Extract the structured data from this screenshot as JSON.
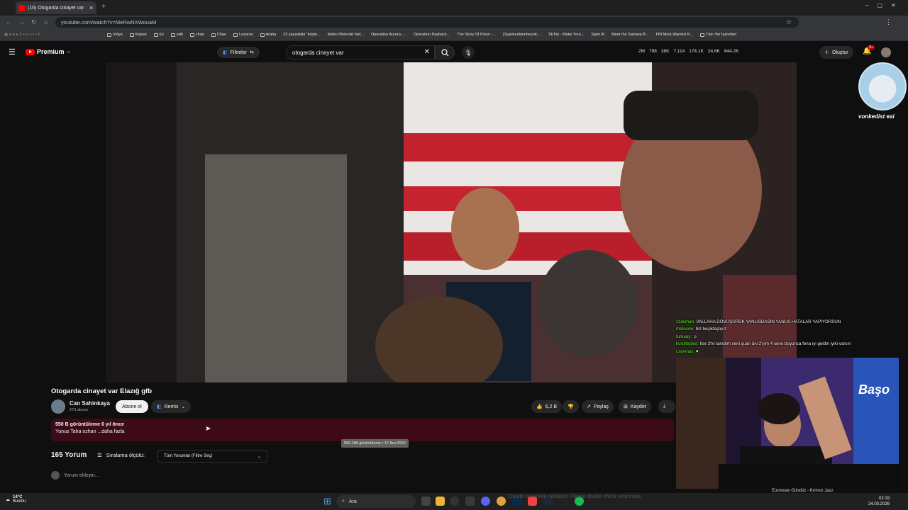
{
  "browser": {
    "tab_title": "(16) Otogarda cinayet var E",
    "url": "youtube.com/watch?v=MeRwNXWouaM",
    "bookmarks": [
      "Vidya",
      "Kişisel",
      "Ev",
      "edit",
      "chan",
      "Chao",
      "Lazarus",
      "Araba",
      "23 yaşındaki \"kripto...",
      "Aiden Pleterski Net...",
      "Operation Aurora -...",
      "Operation Payback...",
      "The Story Of Ponzi -...",
      "(1)gelecektenbeyolc...",
      "TikTok - Make Your...",
      "Satın Al",
      "Meet the Sakawa B...",
      "FBI Most Wanted R...",
      "Tüm Yer İşaretleri"
    ]
  },
  "youtube": {
    "logo_label": "Premium",
    "logo_sup": "TR",
    "filters_label": "Filtreler",
    "search_value": "otogarda cinayet var",
    "stats": [
      "2M",
      "798",
      "38K",
      "7.114",
      "174.1K",
      "24.6K",
      "644.2K"
    ],
    "create_label": "Oluştur",
    "notif_count": "9+"
  },
  "video": {
    "title": "Otogarda cinayet var Elazığ gfb",
    "channel": "Can Sahinkaya",
    "subscribers": "273 abone",
    "subscribe_label": "Abone ol",
    "remix_label": "Remix",
    "likes": "6,2 B",
    "share_label": "Paylaş",
    "save_label": "Kaydet",
    "desc_stats": "550 B görüntüleme  6 yıl önce",
    "desc_text": "Yunus Taha ozhan ...daha fazla",
    "tooltip": "550.186 görüntüleme • 17 Ara 2019"
  },
  "comments": {
    "count_label": "165 Yorum",
    "sort_label": "Sıralama ölçütü:",
    "filter_label": "Tüm Yorumlar (Filtre Seç)",
    "add_placeholder": "Yorum ekleyin..."
  },
  "overlay": {
    "cat_name": "vonkedist eai",
    "chat": [
      {
        "user": "11dsman:",
        "msg": "VALLAHA DÖVÜŞÜRÜK YANLISDASIN YANUS HATALAR YAPIYORSUN"
      },
      {
        "user": "metexcw:",
        "msg": "biz beşiktaşlıyız"
      },
      {
        "user": "turkuay:",
        "msg": "☺"
      },
      {
        "user": "kurultepest:",
        "msg": "lise 3'te tamdım seni şuan üni 2'yim 4 sene boyunca fena iyi geldin iyiki varsın"
      },
      {
        "user": "Lisvenus:",
        "msg": "♥"
      }
    ],
    "cam_logo": "Başo",
    "song": "Eurovoan Gündüz - Kırmızı Jazz"
  },
  "taskbar": {
    "temp": "14°C",
    "weather": "Bulutlu",
    "search": "Ara",
    "claude_note": "Claude can make mistakes. Please double-check responses.",
    "time": "02:19",
    "date": "24.03.2026"
  },
  "colors": {
    "youtube_red": "#ff0000",
    "desc_bg": "#3d0a18",
    "chat_user": "#53fc18"
  }
}
